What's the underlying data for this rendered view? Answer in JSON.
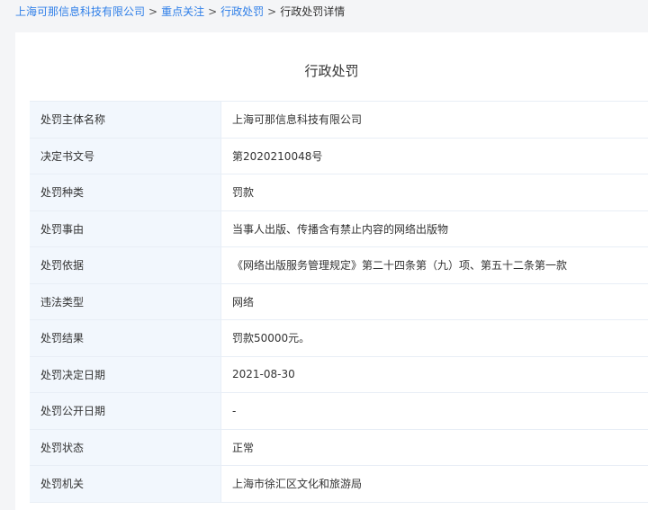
{
  "breadcrumb": {
    "items": [
      {
        "label": "上海可那信息科技有限公司"
      },
      {
        "label": "重点关注"
      },
      {
        "label": "行政处罚"
      }
    ],
    "separator": ">",
    "current": "行政处罚详情"
  },
  "page": {
    "title": "行政处罚"
  },
  "details": [
    {
      "label": "处罚主体名称",
      "value": "上海可那信息科技有限公司"
    },
    {
      "label": "决定书文号",
      "value": "第2020210048号"
    },
    {
      "label": "处罚种类",
      "value": "罚款"
    },
    {
      "label": "处罚事由",
      "value": "当事人出版、传播含有禁止内容的网络出版物"
    },
    {
      "label": "处罚依据",
      "value": "《网络出版服务管理规定》第二十四条第（九）项、第五十二条第一款"
    },
    {
      "label": "违法类型",
      "value": "网络"
    },
    {
      "label": "处罚结果",
      "value": "罚款50000元。"
    },
    {
      "label": "处罚决定日期",
      "value": "2021-08-30"
    },
    {
      "label": "处罚公开日期",
      "value": "-"
    },
    {
      "label": "处罚状态",
      "value": "正常"
    },
    {
      "label": "处罚机关",
      "value": "上海市徐汇区文化和旅游局"
    }
  ],
  "colors": {
    "link": "#2f7fe8",
    "label_bg": "#f2f7fd",
    "border": "#e8eef6",
    "page_bg": "#f4f5f7"
  }
}
